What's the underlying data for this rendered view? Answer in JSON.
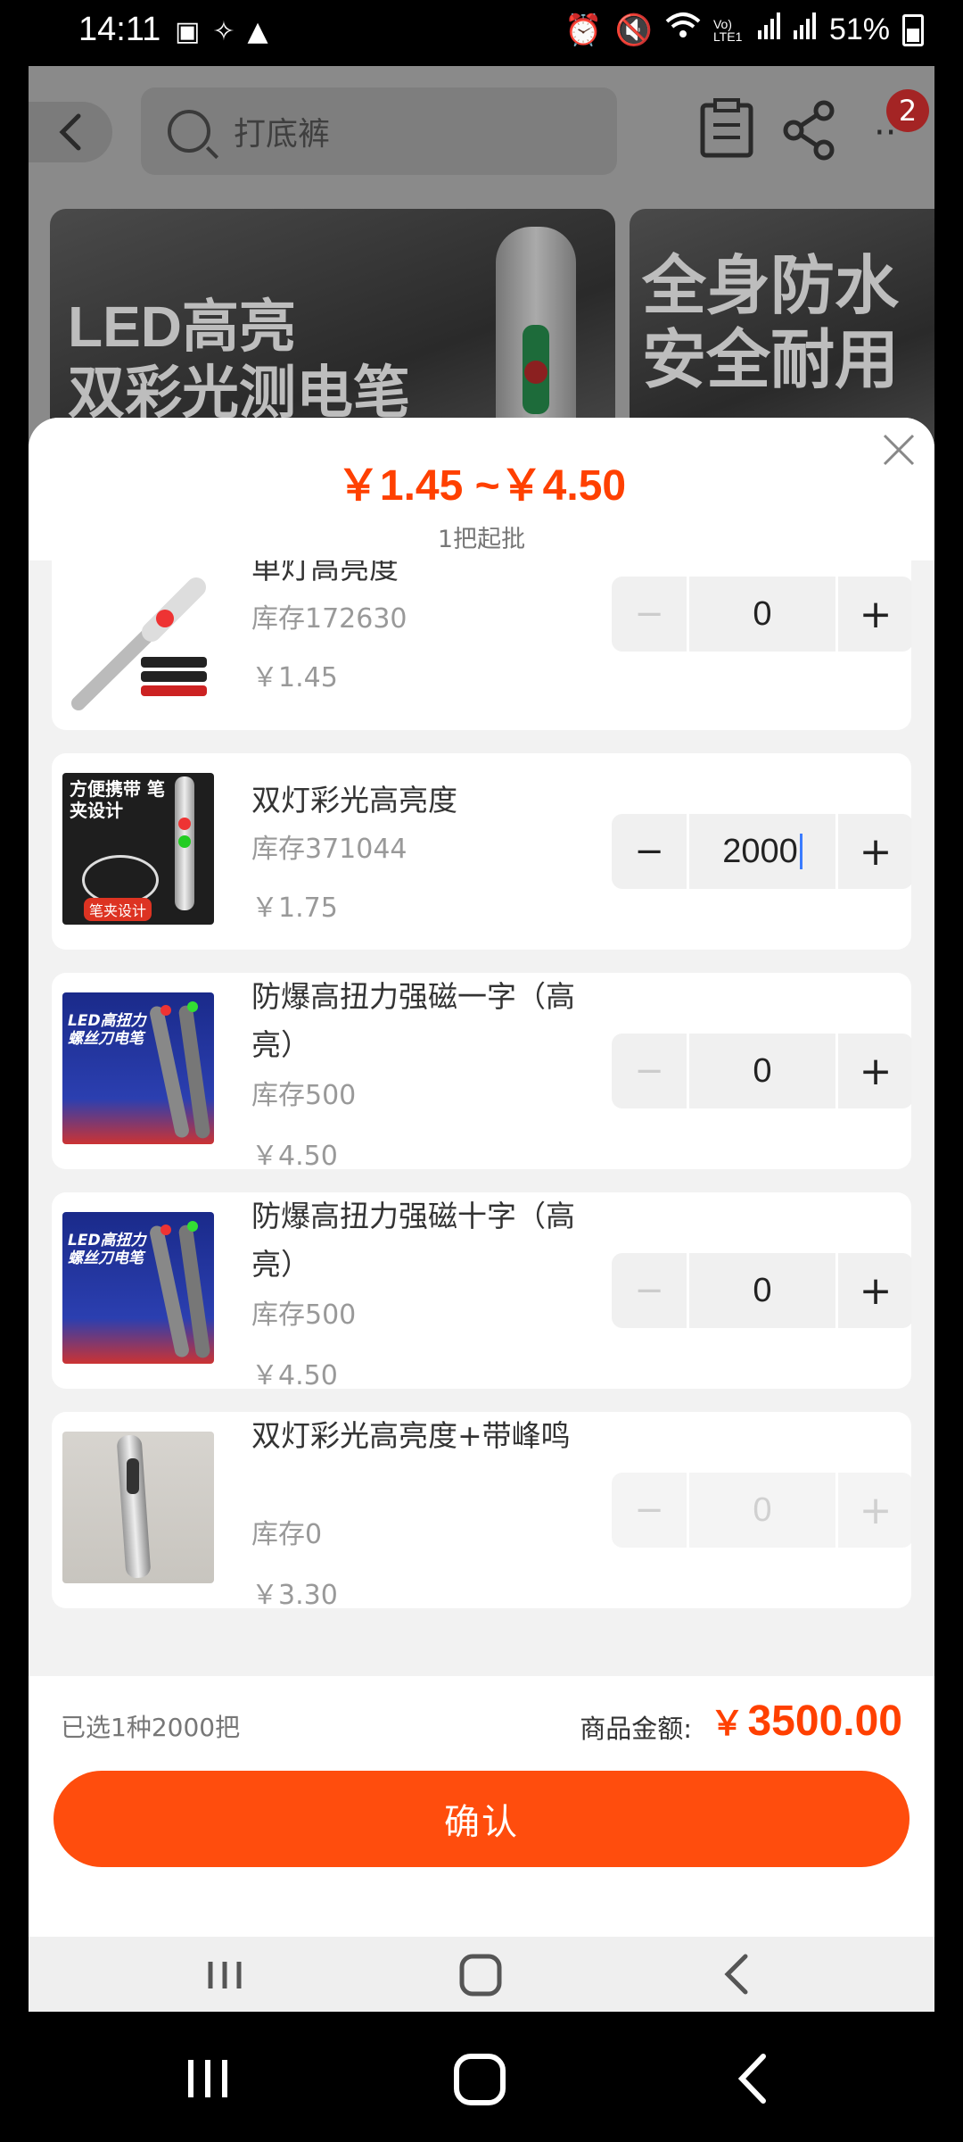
{
  "status_bar": {
    "time": "14:11",
    "battery": "51%",
    "icons": [
      "message-icon",
      "tool-icon",
      "alert-icon",
      "alarm-icon",
      "mute-icon",
      "wifi-icon",
      "volte-icon",
      "signal-icon",
      "signal-icon",
      "battery-icon"
    ],
    "volte": "Vo) LTE1"
  },
  "background_page": {
    "search_placeholder": "打底裤",
    "cart_badge": "2",
    "banner1_line1": "LED高亮",
    "banner1_line2": "双彩光测电笔",
    "banner2_line1": "全身防水",
    "banner2_line2": "安全耐用"
  },
  "sheet": {
    "price_range": "￥1.45 ~￥4.50",
    "moq": "1把起批",
    "items": [
      {
        "name": "单灯高亮度",
        "stock": "库存172630",
        "price": "￥1.45",
        "qty": "0",
        "thumb": "tester-single-light"
      },
      {
        "name": "双灯彩光高亮度",
        "stock": "库存371044",
        "price": "￥1.75",
        "qty": "2000",
        "thumb": "tester-dual-light",
        "thumb_text": "方便携带 笔夹设计",
        "thumb_tag": "笔夹设计"
      },
      {
        "name": "防爆高扭力强磁一字（高亮）",
        "stock": "库存500",
        "price": "￥4.50",
        "qty": "0",
        "thumb": "screwdriver-flat",
        "thumb_text": "LED高扭力 螺丝刀电笔"
      },
      {
        "name": "防爆高扭力强磁十字（高亮）",
        "stock": "库存500",
        "price": "￥4.50",
        "qty": "0",
        "thumb": "screwdriver-cross",
        "thumb_text": "LED高扭力 螺丝刀电笔"
      },
      {
        "name": "双灯彩光高亮度+带峰鸣",
        "stock": "库存0",
        "price": "￥3.30",
        "qty": "0",
        "thumb": "tester-buzzer"
      }
    ],
    "minus_symbol": "−",
    "plus_symbol": "+",
    "selected_summary": "已选1种2000把",
    "amount_label": "商品金额:",
    "amount_currency": "￥",
    "amount_value": "3500.00",
    "confirm_label": "确认"
  },
  "colors": {
    "accent": "#ff4000",
    "confirm_bg": "#ff4d0d",
    "badge": "#a42424"
  }
}
